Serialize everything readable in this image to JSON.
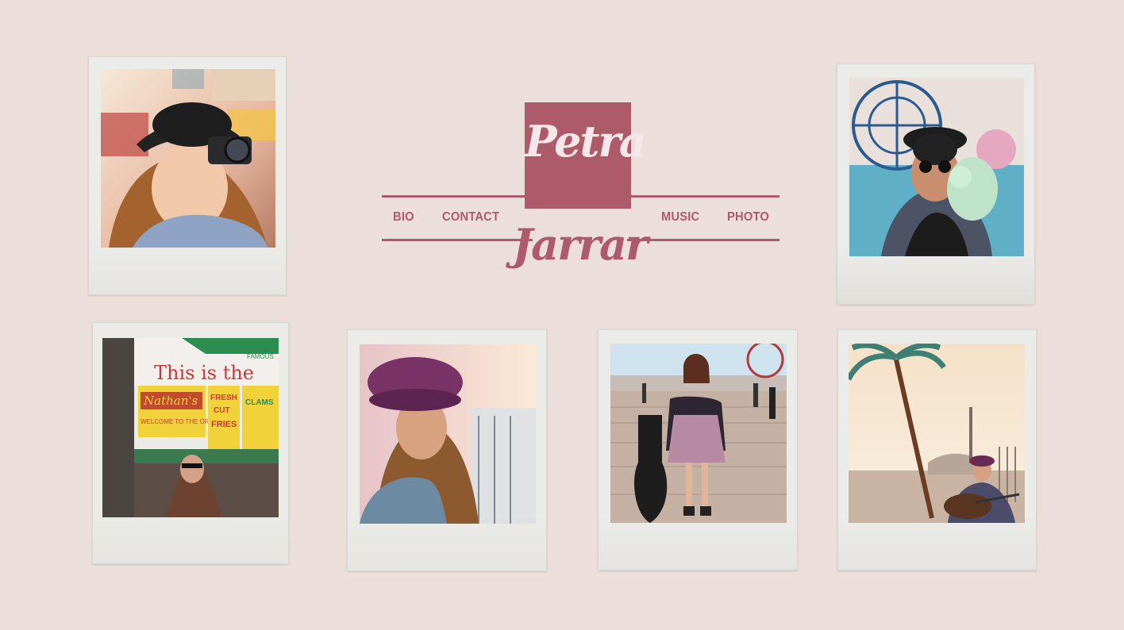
{
  "brand": {
    "first_name": "Petra",
    "last_name": "Jarrar"
  },
  "nav": {
    "left": [
      {
        "label": "BIO"
      },
      {
        "label": "CONTACT"
      }
    ],
    "right": [
      {
        "label": "MUSIC"
      },
      {
        "label": "PHOTO"
      }
    ]
  },
  "colors": {
    "background": "#ecdfda",
    "accent": "#ad5a6b",
    "logo_text": "#f6e7e9",
    "polaroid_frame": "#ebebe8"
  },
  "gallery": {
    "photos": [
      {
        "subject": "woman in black hat taking photo with camera"
      },
      {
        "subject": "woman in sunglasses holding cotton candy by ferris wheel"
      },
      {
        "subject": "woman outside Nathan's hot dog stand"
      },
      {
        "subject": "woman in purple hat on boardwalk"
      },
      {
        "subject": "woman with guitar case on boardwalk"
      },
      {
        "subject": "woman playing guitar on beach by palm tree"
      }
    ],
    "signs": {
      "line1": "This is the",
      "nathans": "Nathan's",
      "fresh": "FRESH",
      "cut": "CUT",
      "fries": "FRIES",
      "welcome": "WELCOME TO THE ORIGINAL",
      "clams": "CLAMS",
      "famous": "FAMOUS"
    }
  }
}
